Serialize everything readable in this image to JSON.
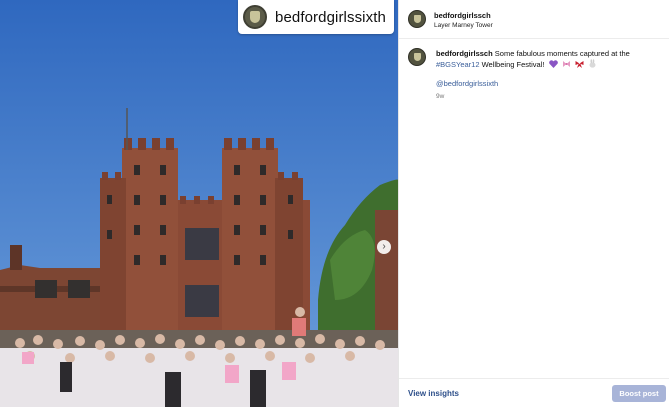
{
  "photo": {
    "tagged_account": "bedfordgirlssixth",
    "next_symbol": "›"
  },
  "post": {
    "username": "bedfordgirlssch",
    "location": "Layer Marney Tower",
    "more_symbol": "···",
    "caption_username": "bedfordgirlssch",
    "caption_text_before": "Some fabulous moments captured at the",
    "caption_hashtag": "#BGSYear12",
    "caption_text_after": "Wellbeing Festival!",
    "mention": "@bedfordgirlssixth",
    "time_ago": "9w"
  },
  "actions": {
    "view_insights": "View insights",
    "boost_post": "Boost post"
  },
  "colors": {
    "sky": "#3f74c6",
    "brick": "#8a4a36",
    "link": "#3a5e9a",
    "boost_button": "#a8b4d8"
  },
  "icons": [
    "avatar-crest",
    "heart-emoji",
    "bow-emoji",
    "ribbon-emoji",
    "rabbit-emoji",
    "chevron-right-icon",
    "more-icon"
  ]
}
